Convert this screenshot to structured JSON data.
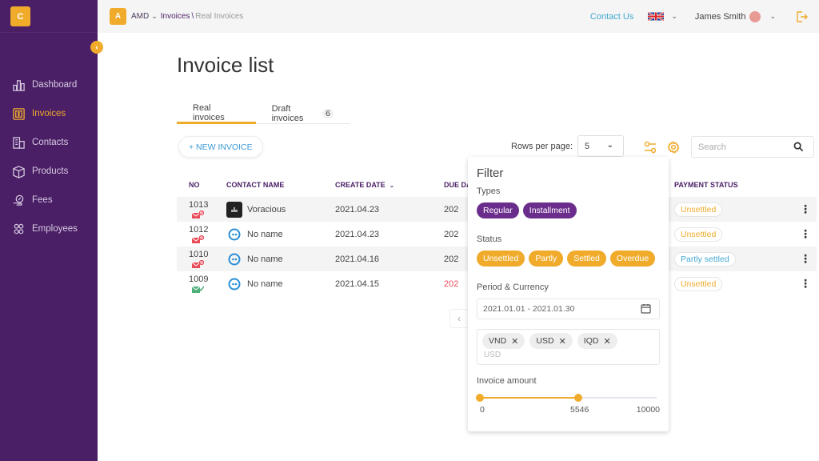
{
  "app": {
    "logo_letter": "C"
  },
  "sidebar": {
    "items": [
      {
        "label": "Dashboard",
        "icon": "bar-chart-icon",
        "active": false
      },
      {
        "label": "Invoices",
        "icon": "invoice-icon",
        "active": true
      },
      {
        "label": "Contacts",
        "icon": "building-icon",
        "active": false
      },
      {
        "label": "Products",
        "icon": "box-icon",
        "active": false
      },
      {
        "label": "Fees",
        "icon": "hand-percent-icon",
        "active": false
      },
      {
        "label": "Employees",
        "icon": "users-icon",
        "active": false
      }
    ]
  },
  "topbar": {
    "org_letter": "A",
    "org_name": "AMD",
    "breadcrumb": [
      "Invoices",
      "Real Invoices"
    ],
    "contact_us": "Contact Us",
    "language": "English (UK)",
    "user_name": "James Smith"
  },
  "main": {
    "title": "Invoice list",
    "tabs": [
      {
        "label": "Real invoices",
        "active": true
      },
      {
        "label": "Draft invoices",
        "count": "6",
        "active": false
      }
    ],
    "new_invoice_label": "+ NEW INVOICE",
    "rows_per_page_label": "Rows per page:",
    "rows_per_page_value": "5",
    "search_placeholder": "Search",
    "table": {
      "columns": [
        "NO",
        "CONTACT NAME",
        "CREATE DATE",
        "DUE DATE",
        "PAYMENT STATUS"
      ],
      "rows": [
        {
          "no": "1013",
          "mail_status": "failed",
          "contact": "Voracious",
          "avatar": "dark",
          "create_date": "2021.04.23",
          "due_date": "202",
          "due_overdue": false,
          "payment_status": "Unsettled",
          "status_type": "unsettled"
        },
        {
          "no": "1012",
          "mail_status": "failed",
          "contact": "No name",
          "avatar": "blue",
          "create_date": "2021.04.23",
          "due_date": "202",
          "due_overdue": false,
          "payment_status": "Unsettled",
          "status_type": "unsettled"
        },
        {
          "no": "1010",
          "mail_status": "failed",
          "contact": "No name",
          "avatar": "blue",
          "create_date": "2021.04.16",
          "due_date": "202",
          "due_overdue": false,
          "payment_status": "Partly settled",
          "status_type": "partly"
        },
        {
          "no": "1009",
          "mail_status": "sent",
          "contact": "No name",
          "avatar": "blue",
          "create_date": "2021.04.15",
          "due_date": "202",
          "due_overdue": true,
          "payment_status": "Unsettled",
          "status_type": "unsettled"
        }
      ]
    }
  },
  "filter": {
    "title": "Filter",
    "types_label": "Types",
    "types": [
      "Regular",
      "Installment"
    ],
    "status_label": "Status",
    "statuses": [
      "Unsettled",
      "Partly",
      "Settled",
      "Overdue"
    ],
    "period_label": "Period & Currency",
    "date_range": "2021.01.01 - 2021.01.30",
    "currencies": [
      "VND",
      "USD",
      "IQD"
    ],
    "currency_placeholder": "USD",
    "amount_label": "Invoice amount",
    "amount_min": 0,
    "amount_max": 10000,
    "amount_selected_low": 0,
    "amount_selected_high": 5546,
    "amount_min_label": "0",
    "amount_high_label": "5546",
    "amount_max_label": "10000"
  },
  "colors": {
    "sidebar_bg": "#4a1f66",
    "accent": "#f0ab2b",
    "purple_chip": "#6b2d8b",
    "link_blue": "#42a8d0",
    "overdue_red": "#e94b59"
  }
}
